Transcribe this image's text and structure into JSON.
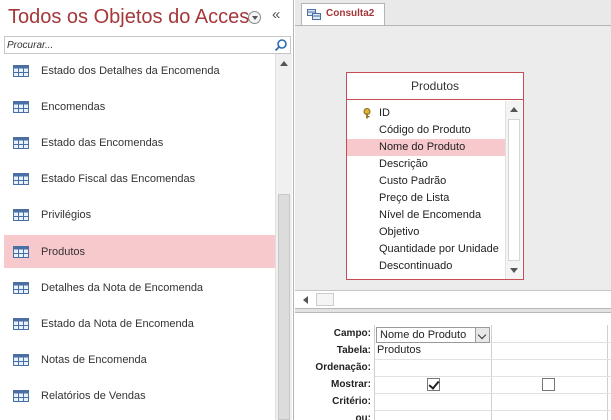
{
  "nav": {
    "title": "Todos os Objetos do Access",
    "search_placeholder": "Procurar...",
    "items": [
      {
        "label": "Estado dos Detalhes da Encomenda",
        "selected": false
      },
      {
        "label": "Encomendas",
        "selected": false
      },
      {
        "label": "Estado das Encomendas",
        "selected": false
      },
      {
        "label": "Estado Fiscal das Encomendas",
        "selected": false
      },
      {
        "label": "Privilégios",
        "selected": false
      },
      {
        "label": "Produtos",
        "selected": true
      },
      {
        "label": "Detalhes da Nota de Encomenda",
        "selected": false
      },
      {
        "label": "Estado da Nota de Encomenda",
        "selected": false
      },
      {
        "label": "Notas de Encomenda",
        "selected": false
      },
      {
        "label": "Relatórios de Vendas",
        "selected": false
      }
    ]
  },
  "tab": {
    "label": "Consulta2"
  },
  "table": {
    "name": "Produtos",
    "fields": [
      "ID",
      "Código do Produto",
      "Nome do Produto",
      "Descrição",
      "Custo Padrão",
      "Preço de Lista",
      "Nível de Encomenda",
      "Objetivo",
      "Quantidade por Unidade",
      "Descontinuado"
    ],
    "selected_field": "Nome do Produto"
  },
  "grid": {
    "row_labels": {
      "field": "Campo:",
      "table": "Tabela:",
      "sort": "Ordenação:",
      "show": "Mostrar:",
      "criteria": "Critério:",
      "or": "ou:"
    },
    "columns": [
      {
        "field": "Nome do Produto",
        "table": "Produtos",
        "show": true
      },
      {
        "field": "",
        "table": "",
        "show": false
      }
    ]
  },
  "colors": {
    "accent": "#a4373a",
    "selection": "#f7c8cc"
  }
}
